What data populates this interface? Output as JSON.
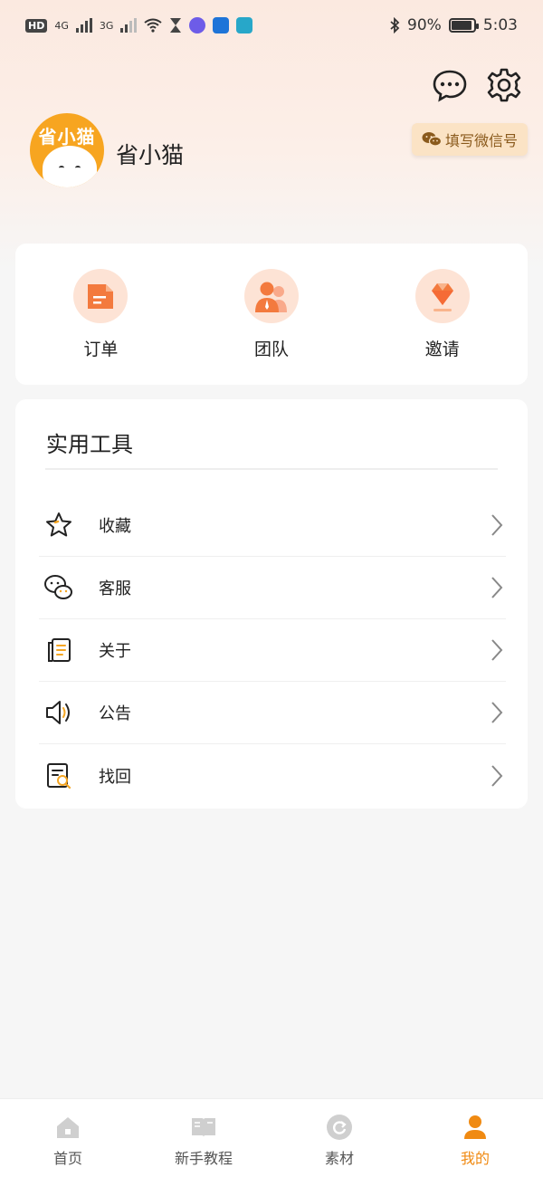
{
  "status_bar": {
    "hd": "HD",
    "sim1": "4G",
    "sim2": "3G",
    "battery_percent": "90%",
    "time": "5:03"
  },
  "header": {
    "message_icon": "chat-bubble-icon",
    "settings_icon": "gear-icon"
  },
  "profile": {
    "avatar_text": "省小猫",
    "username": "省小猫",
    "wechat_button": "填写微信号"
  },
  "quick_actions": [
    {
      "label": "订单",
      "icon": "order-document-icon"
    },
    {
      "label": "团队",
      "icon": "team-people-icon"
    },
    {
      "label": "邀请",
      "icon": "invite-gem-icon"
    }
  ],
  "tools": {
    "title": "实用工具",
    "items": [
      {
        "label": "收藏",
        "icon": "star-icon"
      },
      {
        "label": "客服",
        "icon": "chat-service-icon"
      },
      {
        "label": "关于",
        "icon": "about-doc-icon"
      },
      {
        "label": "公告",
        "icon": "speaker-icon"
      },
      {
        "label": "找回",
        "icon": "search-doc-icon"
      }
    ]
  },
  "tab_bar": {
    "tabs": [
      {
        "label": "首页",
        "icon": "home-icon",
        "active": false
      },
      {
        "label": "新手教程",
        "icon": "book-icon",
        "active": false
      },
      {
        "label": "素材",
        "icon": "refresh-icon",
        "active": false
      },
      {
        "label": "我的",
        "icon": "user-icon",
        "active": true
      }
    ]
  },
  "colors": {
    "accent": "#f08a12",
    "avatar_bg": "#f7a520",
    "wechat_bg": "#fbe3c5"
  }
}
